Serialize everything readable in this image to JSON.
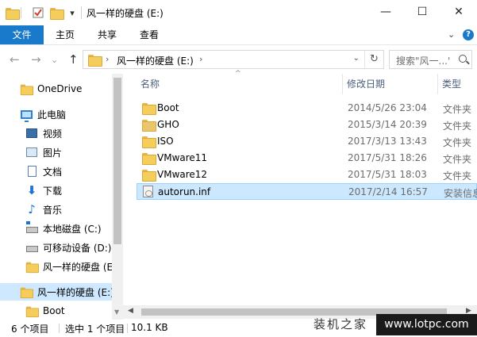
{
  "window": {
    "title": "风一样的硬盘 (E:)",
    "minimize_glyph": "—",
    "maximize_glyph": "☐",
    "close_glyph": "✕"
  },
  "quick_access": {
    "dropdown_glyph": "▾"
  },
  "ribbon": {
    "tabs": [
      "文件",
      "主页",
      "共享",
      "查看"
    ],
    "expand_glyph": "⌄",
    "help_glyph": "?"
  },
  "nav": {
    "back_glyph": "←",
    "forward_glyph": "→",
    "recent_glyph": "⌄",
    "up_glyph": "↑"
  },
  "address": {
    "chevron": "›",
    "path": "风一样的硬盘 (E:)",
    "trail_chevron": "›",
    "dropdown_glyph": "⌄",
    "refresh_glyph": "↻"
  },
  "search": {
    "placeholder": "搜索\"风一...\""
  },
  "sidebar": {
    "items": [
      {
        "label": "OneDrive",
        "icon": "onedrive-folder-icon"
      },
      {
        "label": "此电脑",
        "icon": "computer-icon"
      },
      {
        "label": "视频",
        "icon": "videos-icon"
      },
      {
        "label": "图片",
        "icon": "pictures-icon"
      },
      {
        "label": "文档",
        "icon": "documents-icon"
      },
      {
        "label": "下载",
        "icon": "downloads-icon"
      },
      {
        "label": "音乐",
        "icon": "music-icon"
      },
      {
        "label": "本地磁盘 (C:)",
        "icon": "local-disk-icon"
      },
      {
        "label": "可移动设备 (D:)",
        "icon": "removable-drive-icon"
      },
      {
        "label": "风一样的硬盘 (E",
        "icon": "folder-icon"
      },
      {
        "label": "风一样的硬盘 (E:)",
        "icon": "folder-icon"
      },
      {
        "label": "Boot",
        "icon": "folder-icon"
      }
    ],
    "selected_index": 10
  },
  "columns": {
    "name": "名称",
    "date": "修改日期",
    "type": "类型",
    "sort_glyph": "^"
  },
  "files": [
    {
      "name": "Boot",
      "date": "2014/5/26 23:04",
      "type": "文件夹",
      "icon": "folder-icon"
    },
    {
      "name": "GHO",
      "date": "2015/3/14 20:39",
      "type": "文件夹",
      "icon": "locked-folder-icon"
    },
    {
      "name": "ISO",
      "date": "2017/3/13 13:43",
      "type": "文件夹",
      "icon": "folder-icon"
    },
    {
      "name": "VMware11",
      "date": "2017/5/31 18:26",
      "type": "文件夹",
      "icon": "folder-icon"
    },
    {
      "name": "VMware12",
      "date": "2017/5/31 18:03",
      "type": "文件夹",
      "icon": "folder-icon"
    },
    {
      "name": "autorun.inf",
      "date": "2017/2/14 16:57",
      "type": "安装信息",
      "icon": "inf-file-icon"
    }
  ],
  "selected_file_index": 5,
  "scroll": {
    "up_glyph": "▲",
    "down_glyph": "▼",
    "left_glyph": "◀",
    "right_glyph": "▶"
  },
  "status": {
    "count": "6 个项目",
    "selection": "选中 1 个项目",
    "size": "10.1 KB"
  },
  "watermark": {
    "text": "装机之家",
    "url": "www.lotpc.com"
  },
  "colors": {
    "accent": "#1979ca",
    "selection": "#cce8ff",
    "folder": "#f5cd5b"
  }
}
